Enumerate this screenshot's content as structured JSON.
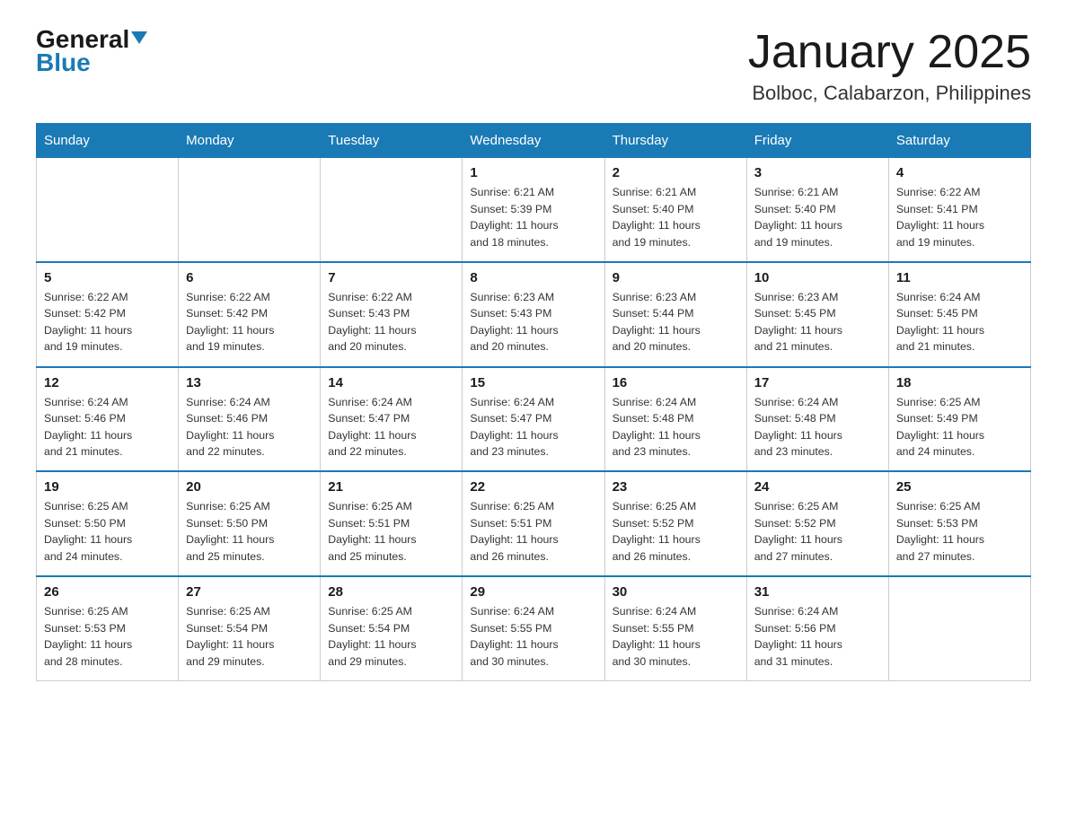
{
  "header": {
    "logo_general": "General",
    "logo_blue": "Blue",
    "month_title": "January 2025",
    "location": "Bolboc, Calabarzon, Philippines"
  },
  "days_of_week": [
    "Sunday",
    "Monday",
    "Tuesday",
    "Wednesday",
    "Thursday",
    "Friday",
    "Saturday"
  ],
  "weeks": [
    [
      {
        "day": "",
        "info": ""
      },
      {
        "day": "",
        "info": ""
      },
      {
        "day": "",
        "info": ""
      },
      {
        "day": "1",
        "info": "Sunrise: 6:21 AM\nSunset: 5:39 PM\nDaylight: 11 hours\nand 18 minutes."
      },
      {
        "day": "2",
        "info": "Sunrise: 6:21 AM\nSunset: 5:40 PM\nDaylight: 11 hours\nand 19 minutes."
      },
      {
        "day": "3",
        "info": "Sunrise: 6:21 AM\nSunset: 5:40 PM\nDaylight: 11 hours\nand 19 minutes."
      },
      {
        "day": "4",
        "info": "Sunrise: 6:22 AM\nSunset: 5:41 PM\nDaylight: 11 hours\nand 19 minutes."
      }
    ],
    [
      {
        "day": "5",
        "info": "Sunrise: 6:22 AM\nSunset: 5:42 PM\nDaylight: 11 hours\nand 19 minutes."
      },
      {
        "day": "6",
        "info": "Sunrise: 6:22 AM\nSunset: 5:42 PM\nDaylight: 11 hours\nand 19 minutes."
      },
      {
        "day": "7",
        "info": "Sunrise: 6:22 AM\nSunset: 5:43 PM\nDaylight: 11 hours\nand 20 minutes."
      },
      {
        "day": "8",
        "info": "Sunrise: 6:23 AM\nSunset: 5:43 PM\nDaylight: 11 hours\nand 20 minutes."
      },
      {
        "day": "9",
        "info": "Sunrise: 6:23 AM\nSunset: 5:44 PM\nDaylight: 11 hours\nand 20 minutes."
      },
      {
        "day": "10",
        "info": "Sunrise: 6:23 AM\nSunset: 5:45 PM\nDaylight: 11 hours\nand 21 minutes."
      },
      {
        "day": "11",
        "info": "Sunrise: 6:24 AM\nSunset: 5:45 PM\nDaylight: 11 hours\nand 21 minutes."
      }
    ],
    [
      {
        "day": "12",
        "info": "Sunrise: 6:24 AM\nSunset: 5:46 PM\nDaylight: 11 hours\nand 21 minutes."
      },
      {
        "day": "13",
        "info": "Sunrise: 6:24 AM\nSunset: 5:46 PM\nDaylight: 11 hours\nand 22 minutes."
      },
      {
        "day": "14",
        "info": "Sunrise: 6:24 AM\nSunset: 5:47 PM\nDaylight: 11 hours\nand 22 minutes."
      },
      {
        "day": "15",
        "info": "Sunrise: 6:24 AM\nSunset: 5:47 PM\nDaylight: 11 hours\nand 23 minutes."
      },
      {
        "day": "16",
        "info": "Sunrise: 6:24 AM\nSunset: 5:48 PM\nDaylight: 11 hours\nand 23 minutes."
      },
      {
        "day": "17",
        "info": "Sunrise: 6:24 AM\nSunset: 5:48 PM\nDaylight: 11 hours\nand 23 minutes."
      },
      {
        "day": "18",
        "info": "Sunrise: 6:25 AM\nSunset: 5:49 PM\nDaylight: 11 hours\nand 24 minutes."
      }
    ],
    [
      {
        "day": "19",
        "info": "Sunrise: 6:25 AM\nSunset: 5:50 PM\nDaylight: 11 hours\nand 24 minutes."
      },
      {
        "day": "20",
        "info": "Sunrise: 6:25 AM\nSunset: 5:50 PM\nDaylight: 11 hours\nand 25 minutes."
      },
      {
        "day": "21",
        "info": "Sunrise: 6:25 AM\nSunset: 5:51 PM\nDaylight: 11 hours\nand 25 minutes."
      },
      {
        "day": "22",
        "info": "Sunrise: 6:25 AM\nSunset: 5:51 PM\nDaylight: 11 hours\nand 26 minutes."
      },
      {
        "day": "23",
        "info": "Sunrise: 6:25 AM\nSunset: 5:52 PM\nDaylight: 11 hours\nand 26 minutes."
      },
      {
        "day": "24",
        "info": "Sunrise: 6:25 AM\nSunset: 5:52 PM\nDaylight: 11 hours\nand 27 minutes."
      },
      {
        "day": "25",
        "info": "Sunrise: 6:25 AM\nSunset: 5:53 PM\nDaylight: 11 hours\nand 27 minutes."
      }
    ],
    [
      {
        "day": "26",
        "info": "Sunrise: 6:25 AM\nSunset: 5:53 PM\nDaylight: 11 hours\nand 28 minutes."
      },
      {
        "day": "27",
        "info": "Sunrise: 6:25 AM\nSunset: 5:54 PM\nDaylight: 11 hours\nand 29 minutes."
      },
      {
        "day": "28",
        "info": "Sunrise: 6:25 AM\nSunset: 5:54 PM\nDaylight: 11 hours\nand 29 minutes."
      },
      {
        "day": "29",
        "info": "Sunrise: 6:24 AM\nSunset: 5:55 PM\nDaylight: 11 hours\nand 30 minutes."
      },
      {
        "day": "30",
        "info": "Sunrise: 6:24 AM\nSunset: 5:55 PM\nDaylight: 11 hours\nand 30 minutes."
      },
      {
        "day": "31",
        "info": "Sunrise: 6:24 AM\nSunset: 5:56 PM\nDaylight: 11 hours\nand 31 minutes."
      },
      {
        "day": "",
        "info": ""
      }
    ]
  ]
}
